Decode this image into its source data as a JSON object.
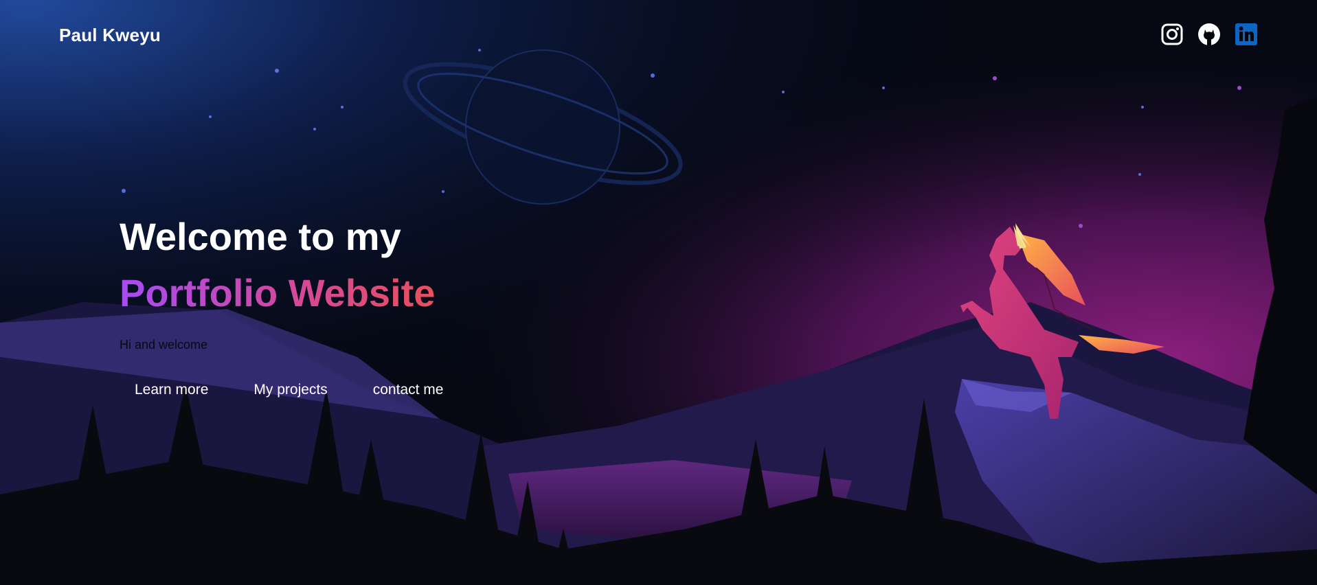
{
  "header": {
    "brand": "Paul Kweyu"
  },
  "socials": [
    {
      "icon": "instagram-icon",
      "color": "#ffffff"
    },
    {
      "icon": "github-icon",
      "color": "#ffffff"
    },
    {
      "icon": "linkedin-icon",
      "color": "#0a66c2"
    }
  ],
  "hero": {
    "line1": "Welcome to my",
    "line2": "Portfolio Website",
    "tagline": "Hi and welcome"
  },
  "nav": {
    "learn_more": "Learn more",
    "projects": "My projects",
    "contact": "contact me"
  },
  "colors": {
    "gradient_start": "#a64bf4",
    "gradient_end": "#e8505b",
    "sky_top": "#1b3a7a",
    "sky_glow": "#7a1a6e"
  }
}
